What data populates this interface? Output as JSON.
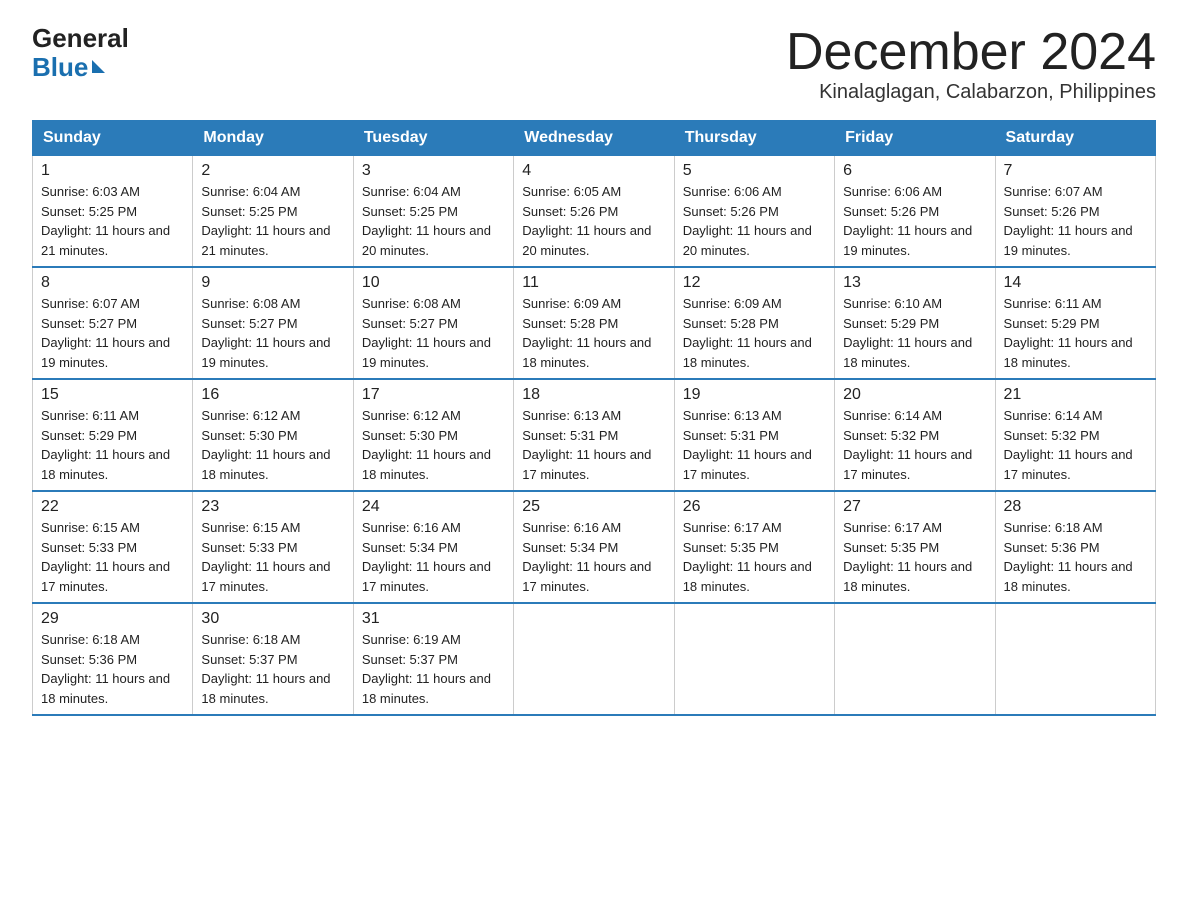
{
  "logo": {
    "line1": "General",
    "line2": "Blue"
  },
  "title": "December 2024",
  "location": "Kinalaglagan, Calabarzon, Philippines",
  "days_header": [
    "Sunday",
    "Monday",
    "Tuesday",
    "Wednesday",
    "Thursday",
    "Friday",
    "Saturday"
  ],
  "weeks": [
    [
      {
        "day": "1",
        "sunrise": "6:03 AM",
        "sunset": "5:25 PM",
        "daylight": "11 hours and 21 minutes."
      },
      {
        "day": "2",
        "sunrise": "6:04 AM",
        "sunset": "5:25 PM",
        "daylight": "11 hours and 21 minutes."
      },
      {
        "day": "3",
        "sunrise": "6:04 AM",
        "sunset": "5:25 PM",
        "daylight": "11 hours and 20 minutes."
      },
      {
        "day": "4",
        "sunrise": "6:05 AM",
        "sunset": "5:26 PM",
        "daylight": "11 hours and 20 minutes."
      },
      {
        "day": "5",
        "sunrise": "6:06 AM",
        "sunset": "5:26 PM",
        "daylight": "11 hours and 20 minutes."
      },
      {
        "day": "6",
        "sunrise": "6:06 AM",
        "sunset": "5:26 PM",
        "daylight": "11 hours and 19 minutes."
      },
      {
        "day": "7",
        "sunrise": "6:07 AM",
        "sunset": "5:26 PM",
        "daylight": "11 hours and 19 minutes."
      }
    ],
    [
      {
        "day": "8",
        "sunrise": "6:07 AM",
        "sunset": "5:27 PM",
        "daylight": "11 hours and 19 minutes."
      },
      {
        "day": "9",
        "sunrise": "6:08 AM",
        "sunset": "5:27 PM",
        "daylight": "11 hours and 19 minutes."
      },
      {
        "day": "10",
        "sunrise": "6:08 AM",
        "sunset": "5:27 PM",
        "daylight": "11 hours and 19 minutes."
      },
      {
        "day": "11",
        "sunrise": "6:09 AM",
        "sunset": "5:28 PM",
        "daylight": "11 hours and 18 minutes."
      },
      {
        "day": "12",
        "sunrise": "6:09 AM",
        "sunset": "5:28 PM",
        "daylight": "11 hours and 18 minutes."
      },
      {
        "day": "13",
        "sunrise": "6:10 AM",
        "sunset": "5:29 PM",
        "daylight": "11 hours and 18 minutes."
      },
      {
        "day": "14",
        "sunrise": "6:11 AM",
        "sunset": "5:29 PM",
        "daylight": "11 hours and 18 minutes."
      }
    ],
    [
      {
        "day": "15",
        "sunrise": "6:11 AM",
        "sunset": "5:29 PM",
        "daylight": "11 hours and 18 minutes."
      },
      {
        "day": "16",
        "sunrise": "6:12 AM",
        "sunset": "5:30 PM",
        "daylight": "11 hours and 18 minutes."
      },
      {
        "day": "17",
        "sunrise": "6:12 AM",
        "sunset": "5:30 PM",
        "daylight": "11 hours and 18 minutes."
      },
      {
        "day": "18",
        "sunrise": "6:13 AM",
        "sunset": "5:31 PM",
        "daylight": "11 hours and 17 minutes."
      },
      {
        "day": "19",
        "sunrise": "6:13 AM",
        "sunset": "5:31 PM",
        "daylight": "11 hours and 17 minutes."
      },
      {
        "day": "20",
        "sunrise": "6:14 AM",
        "sunset": "5:32 PM",
        "daylight": "11 hours and 17 minutes."
      },
      {
        "day": "21",
        "sunrise": "6:14 AM",
        "sunset": "5:32 PM",
        "daylight": "11 hours and 17 minutes."
      }
    ],
    [
      {
        "day": "22",
        "sunrise": "6:15 AM",
        "sunset": "5:33 PM",
        "daylight": "11 hours and 17 minutes."
      },
      {
        "day": "23",
        "sunrise": "6:15 AM",
        "sunset": "5:33 PM",
        "daylight": "11 hours and 17 minutes."
      },
      {
        "day": "24",
        "sunrise": "6:16 AM",
        "sunset": "5:34 PM",
        "daylight": "11 hours and 17 minutes."
      },
      {
        "day": "25",
        "sunrise": "6:16 AM",
        "sunset": "5:34 PM",
        "daylight": "11 hours and 17 minutes."
      },
      {
        "day": "26",
        "sunrise": "6:17 AM",
        "sunset": "5:35 PM",
        "daylight": "11 hours and 18 minutes."
      },
      {
        "day": "27",
        "sunrise": "6:17 AM",
        "sunset": "5:35 PM",
        "daylight": "11 hours and 18 minutes."
      },
      {
        "day": "28",
        "sunrise": "6:18 AM",
        "sunset": "5:36 PM",
        "daylight": "11 hours and 18 minutes."
      }
    ],
    [
      {
        "day": "29",
        "sunrise": "6:18 AM",
        "sunset": "5:36 PM",
        "daylight": "11 hours and 18 minutes."
      },
      {
        "day": "30",
        "sunrise": "6:18 AM",
        "sunset": "5:37 PM",
        "daylight": "11 hours and 18 minutes."
      },
      {
        "day": "31",
        "sunrise": "6:19 AM",
        "sunset": "5:37 PM",
        "daylight": "11 hours and 18 minutes."
      },
      null,
      null,
      null,
      null
    ]
  ]
}
